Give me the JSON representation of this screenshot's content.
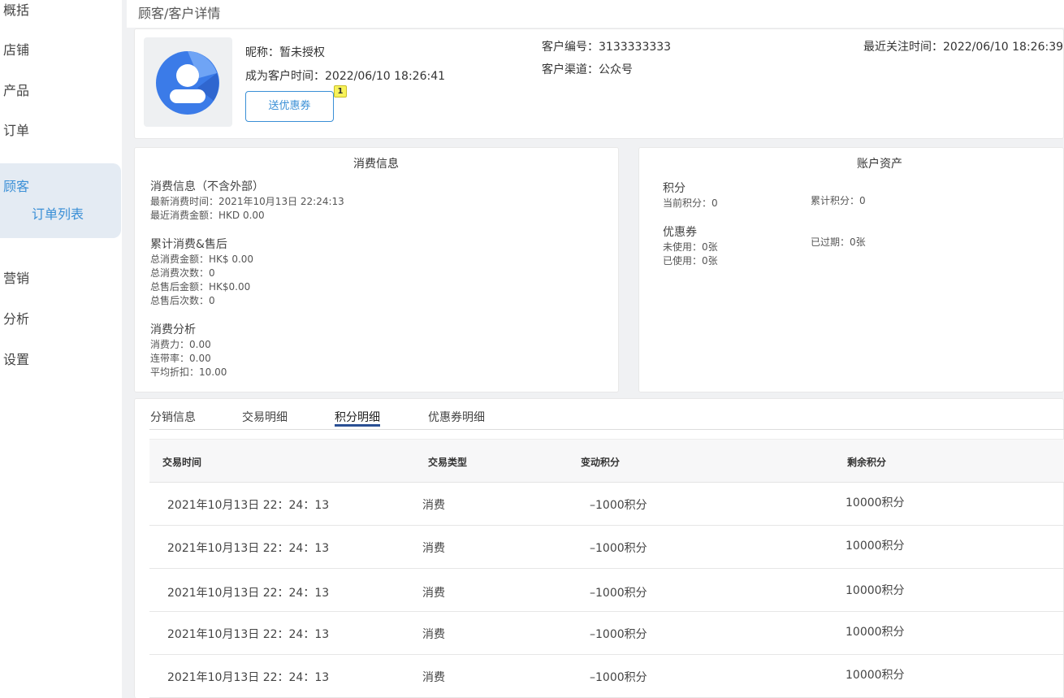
{
  "sidebar": {
    "items": [
      {
        "label": "概括"
      },
      {
        "label": "店铺"
      },
      {
        "label": "产品"
      },
      {
        "label": "订单"
      },
      {
        "label": "顾客"
      },
      {
        "label": "营销"
      },
      {
        "label": "分析"
      },
      {
        "label": "设置"
      }
    ],
    "sub_item": "订单列表"
  },
  "page_title": "顾客/客户详情",
  "profile": {
    "nickname_label": "昵称：暂未授权",
    "became_customer": "成为客户时间：2022/06/10   18:26:41",
    "coupon_button": "送优惠券",
    "badge_count": "1",
    "customer_id": "客户编号：3133333333",
    "channel": "客户渠道：公众号",
    "last_follow": "最近关注时间：2022/06/10   18:26:39"
  },
  "consumption": {
    "title": "消费信息",
    "group1_title": "消费信息（不含外部）",
    "latest_time": "最新消费时间：2021年10月13日 22:24:13",
    "latest_amount": "最近消费金额：HKD  0.00",
    "group2_title": "累计消费&售后",
    "total_amount": "总消费金额：HK$ 0.00",
    "total_count": "总消费次数：0",
    "total_refund_amount": "总售后金额：HK$0.00",
    "total_refund_count": "总售后次数：0",
    "group3_title": "消费分析",
    "power": "消费力：0.00",
    "joint_rate": "连带率：0.00",
    "avg_discount": "平均折扣：10.00"
  },
  "assets": {
    "title": "账户资产",
    "points_title": "积分",
    "current_points": "当前积分：0",
    "total_points": "累计积分：0",
    "coupon_title": "优惠券",
    "unused": "未使用：0张",
    "expired": "已过期：0张",
    "used": "已使用：0张"
  },
  "tabs": [
    {
      "label": "分销信息"
    },
    {
      "label": "交易明细"
    },
    {
      "label": "积分明细"
    },
    {
      "label": "优惠券明细"
    }
  ],
  "active_tab": "积分明细",
  "table": {
    "headers": [
      "交易时间",
      "交易类型",
      "变动积分",
      "剩余积分"
    ],
    "rows": [
      [
        "2021年10月13日 22：24：13",
        "消费",
        "–1000积分",
        "10000积分"
      ],
      [
        "2021年10月13日 22：24：13",
        "消费",
        "–1000积分",
        "10000积分"
      ],
      [
        "2021年10月13日 22：24：13",
        "消费",
        "–1000积分",
        "10000积分"
      ],
      [
        "2021年10月13日 22：24：13",
        "消费",
        "–1000积分",
        "10000积分"
      ],
      [
        "2021年10月13日 22：24：13",
        "消费",
        "–1000积分",
        "10000积分"
      ]
    ]
  },
  "colors": {
    "accent": "#3a8fd6",
    "active_nav_bg": "#e4ebf3",
    "tab_underline": "#2a4f94",
    "avatar_blue": "#3b7be8"
  },
  "icons": {
    "avatar": "user-avatar-icon"
  }
}
